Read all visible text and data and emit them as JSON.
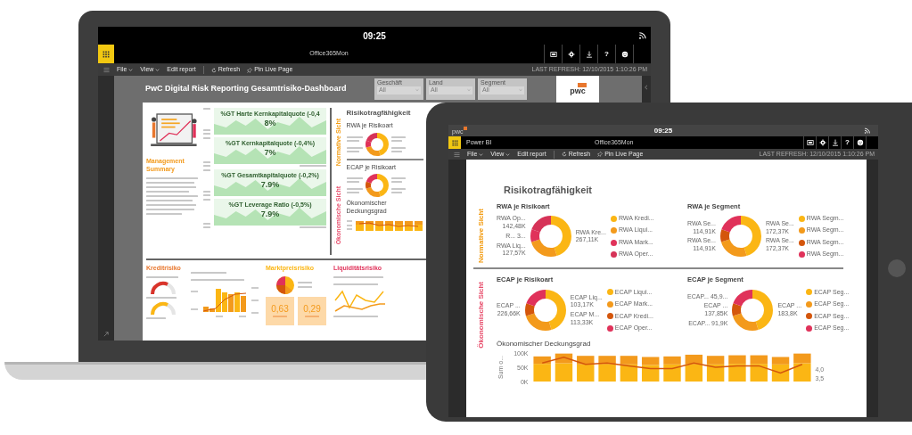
{
  "laptop": {
    "clock": "09:25",
    "app_bar": {
      "title": "Office365Mon",
      "help_glyph": "?"
    },
    "toolbar": {
      "items": [
        "File",
        "View",
        "Edit report",
        "Refresh",
        "Pin Live Page"
      ],
      "last_refresh": "LAST REFRESH: 12/10/2015 1:10:26 PM"
    },
    "report": {
      "title": "PwC Digital Risk Reporting Gesamtrisiko-Dashboard",
      "slicers": [
        {
          "label": "Geschäft",
          "value": "All"
        },
        {
          "label": "Land",
          "value": "All"
        },
        {
          "label": "Segment",
          "value": "All"
        }
      ],
      "logo": "pwc",
      "summary": {
        "heading": "Management Summary"
      },
      "kpis": [
        {
          "title": "%GT Harte Kernkapitalquote (-0,4",
          "value": "8%"
        },
        {
          "title": "%GT Kernkapitalquote (-0,4%)",
          "value": "7%"
        },
        {
          "title": "%GT Gesamtkapitalquote (-0,2%)",
          "value": "7.9%"
        },
        {
          "title": "%GT Leverage Ratio (-0,5%)",
          "value": "7.9%"
        }
      ],
      "risk_panel": {
        "heading": "Risikotragfähigkeit",
        "side_labels": [
          {
            "text": "Normative Sicht",
            "color": "#f39c12"
          },
          {
            "text": "Ökonomische Sicht",
            "color": "#e8506e"
          }
        ],
        "donuts": [
          {
            "title": "RWA je Risikoart",
            "segments": [
              {
                "color": "#fbb614"
              },
              {
                "color": "#f39a1c"
              },
              {
                "color": "#e0325a"
              },
              {
                "color": "#d63358"
              }
            ]
          },
          {
            "title": "ECAP je Risikoart",
            "segments": [
              {
                "color": "#fbb614"
              },
              {
                "color": "#f39a1c"
              },
              {
                "color": "#d4560c"
              },
              {
                "color": "#e0325a"
              }
            ]
          }
        ],
        "coverage": {
          "title": "Ökonomischer Deckungsgrad"
        }
      },
      "credit": {
        "heading": "Kreditrisiko"
      },
      "market": {
        "heading": "Marktpreisrisiko",
        "cards": [
          {
            "value": "0,63"
          },
          {
            "value": "0,29"
          }
        ]
      },
      "liquidity": {
        "heading": "Liquiditätsrisiko"
      }
    }
  },
  "tablet": {
    "clock": "09:25",
    "logo": "pwc",
    "app_bar": {
      "brand": "Power BI",
      "title": "Office365Mon",
      "help_glyph": "?"
    },
    "toolbar": {
      "items": [
        "File",
        "View",
        "Edit report",
        "Refresh",
        "Pin Live Page"
      ],
      "last_refresh": "LAST REFRESH: 12/10/2015 1:10:26 PM"
    },
    "report": {
      "heading": "Risikotragfähigkeit",
      "sections": [
        {
          "side_label": "Normative Sicht",
          "color": "#f39c12",
          "donuts": [
            {
              "title": "RWA je Risikoart",
              "labels_left": [
                {
                  "name": "RWA Op...",
                  "value": "142,48K"
                },
                {
                  "name": "R... 3..."
                },
                {
                  "name": "RWA Liq...",
                  "value": "127,57K"
                }
              ],
              "labels_right": [
                {
                  "name": "RWA Kre...",
                  "value": "267,11K"
                }
              ],
              "legend": [
                {
                  "label": "RWA Kredi...",
                  "color": "#fbb614"
                },
                {
                  "label": "RWA Liqui...",
                  "color": "#f39a1c"
                },
                {
                  "label": "RWA Mark...",
                  "color": "#e0325a"
                },
                {
                  "label": "RWA Oper...",
                  "color": "#d63358"
                }
              ]
            },
            {
              "title": "RWA je Segment",
              "labels_left": [
                {
                  "name": "RWA Se...",
                  "value": "114,91K"
                },
                {
                  "name": "RWA Se...",
                  "value": "114,91K"
                }
              ],
              "labels_right": [
                {
                  "name": "RWA Se...",
                  "value": "172,37K"
                },
                {
                  "name": "RWA Se...",
                  "value": "172,37K"
                }
              ],
              "legend": [
                {
                  "label": "RWA Segm...",
                  "color": "#fbb614"
                },
                {
                  "label": "RWA Segm...",
                  "color": "#f39a1c"
                },
                {
                  "label": "RWA Segm...",
                  "color": "#d4560c"
                },
                {
                  "label": "RWA Segm...",
                  "color": "#e0325a"
                }
              ]
            }
          ]
        },
        {
          "side_label": "Ökonomische Sicht",
          "color": "#e8506e",
          "donuts": [
            {
              "title": "ECAP je Risikoart",
              "labels_left": [
                {
                  "name": "ECAP ...",
                  "value": "226,66K"
                }
              ],
              "labels_right": [
                {
                  "name": "ECAP Liq...",
                  "value": "103,17K"
                },
                {
                  "name": "ECAP M...",
                  "value": "113,33K"
                }
              ],
              "legend": [
                {
                  "label": "ECAP Liqui...",
                  "color": "#fbb614"
                },
                {
                  "label": "ECAP Mark...",
                  "color": "#f39a1c"
                },
                {
                  "label": "ECAP Kredi...",
                  "color": "#d4560c"
                },
                {
                  "label": "ECAP Oper...",
                  "color": "#e0325a"
                }
              ]
            },
            {
              "title": "ECAP je Segment",
              "labels_left": [
                {
                  "name": "ECAP... 45,9..."
                },
                {
                  "name": "ECAP ...",
                  "value": "137,85K"
                },
                {
                  "name": "ECAP... 91,9K"
                }
              ],
              "labels_right": [
                {
                  "name": "ECAP ...",
                  "value": "183,8K"
                }
              ],
              "legend": [
                {
                  "label": "ECAP Seg...",
                  "color": "#fbb614"
                },
                {
                  "label": "ECAP Seg...",
                  "color": "#f39a1c"
                },
                {
                  "label": "ECAP Seg...",
                  "color": "#d4560c"
                },
                {
                  "label": "ECAP Seg...",
                  "color": "#e0325a"
                }
              ]
            }
          ],
          "coverage": {
            "title": "Ökonomischer Deckungsgrad",
            "right_ticks": [
              "4,0",
              "3,5"
            ],
            "chart_data": {
              "type": "bar",
              "ylabel": "Sum o...",
              "stacked": true,
              "ylim": [
                0,
                100000
              ],
              "yticks": [
                {
                  "value": 0,
                  "label": "0K"
                },
                {
                  "value": 50000,
                  "label": "50K"
                },
                {
                  "value": 100000,
                  "label": "100K"
                }
              ],
              "series": [
                {
                  "color": "#fbb614",
                  "values": [
                    62000,
                    64000,
                    60000,
                    62000,
                    60000,
                    58000,
                    60000,
                    62000,
                    60000,
                    62000,
                    62000,
                    60000,
                    64000
                  ]
                },
                {
                  "color": "#f39a1c",
                  "values": [
                    26000,
                    34000,
                    30000,
                    28000,
                    30000,
                    28000,
                    28000,
                    32000,
                    30000,
                    30000,
                    30000,
                    26000,
                    34000
                  ]
                },
                {
                  "color": "#d4560c",
                  "type": "line",
                  "values": [
                    65000,
                    85000,
                    60000,
                    65000,
                    55000,
                    45000,
                    45000,
                    65000,
                    50000,
                    55000,
                    55000,
                    30000,
                    60000
                  ]
                }
              ]
            }
          }
        }
      ]
    }
  }
}
